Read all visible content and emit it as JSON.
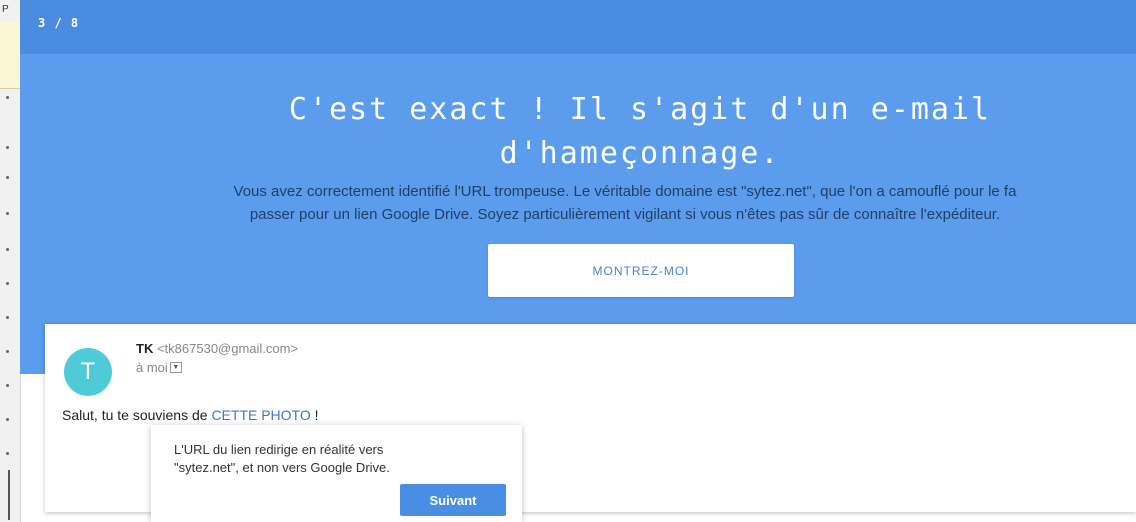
{
  "header": {
    "counter": "3 / 8"
  },
  "hero": {
    "title_line1": "C'est exact ! Il s'agit d'un e-mail",
    "title_line2": "d'hameçonnage.",
    "description_line1": "Vous avez correctement identifié l'URL trompeuse. Le véritable domaine est \"sytez.net\", que l'on a camouflé pour le fa",
    "description_line2": "passer pour un lien Google Drive. Soyez particulièrement vigilant si vous n'êtes pas sûr de connaître l'expéditeur.",
    "button_label": "MONTREZ-MOI"
  },
  "email": {
    "avatar_letter": "T",
    "sender_name": "TK",
    "sender_email": "<tk867530@gmail.com>",
    "recipient": "à moi",
    "body_prefix": "Salut, tu te souviens de ",
    "link_text": "CETTE PHOTO",
    "body_suffix": " !"
  },
  "tooltip": {
    "text_line1": "L'URL du lien redirige en réalité vers",
    "text_line2": "\"sytez.net\", et non vers Google Drive.",
    "button_label": "Suivant"
  },
  "colors": {
    "header": "#4a8de0",
    "hero": "#5b9cec",
    "avatar": "#4fcbd8",
    "link": "#3f73d6",
    "next_button": "#4a8ee3"
  },
  "icons": {
    "recipient_dropdown": "chevron-down-icon"
  }
}
